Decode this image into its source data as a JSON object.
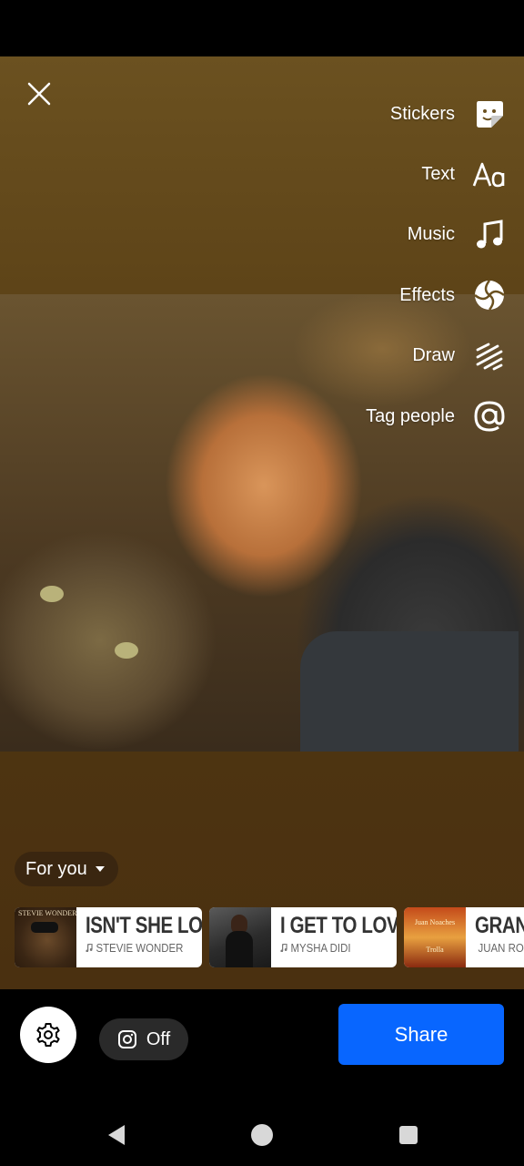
{
  "editor": {
    "close_icon": "close-icon",
    "tools": [
      {
        "label": "Stickers",
        "icon": "sticker-icon"
      },
      {
        "label": "Text",
        "icon": "text-aa-icon"
      },
      {
        "label": "Music",
        "icon": "music-note-icon"
      },
      {
        "label": "Effects",
        "icon": "effects-icon"
      },
      {
        "label": "Draw",
        "icon": "draw-squiggle-icon"
      },
      {
        "label": "Tag people",
        "icon": "at-sign-icon"
      }
    ]
  },
  "music": {
    "filter_label": "For you",
    "tracks": [
      {
        "title": "ISN'T SHE LOVELY",
        "artist": "STEVIE WONDER",
        "album_text": "STEVIE WONDER"
      },
      {
        "title": "I GET TO LOVE YOU",
        "artist": "MYSHA DIDI",
        "album_text": ""
      },
      {
        "title": "GRANDE",
        "artist": "JUAN RO",
        "album_text": "Juan Noaches Trolla"
      }
    ]
  },
  "footer": {
    "instagram_toggle": "Off",
    "share_label": "Share"
  },
  "colors": {
    "share_button": "#0866ff",
    "canvas_top": "#6b5120",
    "canvas_bottom": "#4a3010"
  }
}
